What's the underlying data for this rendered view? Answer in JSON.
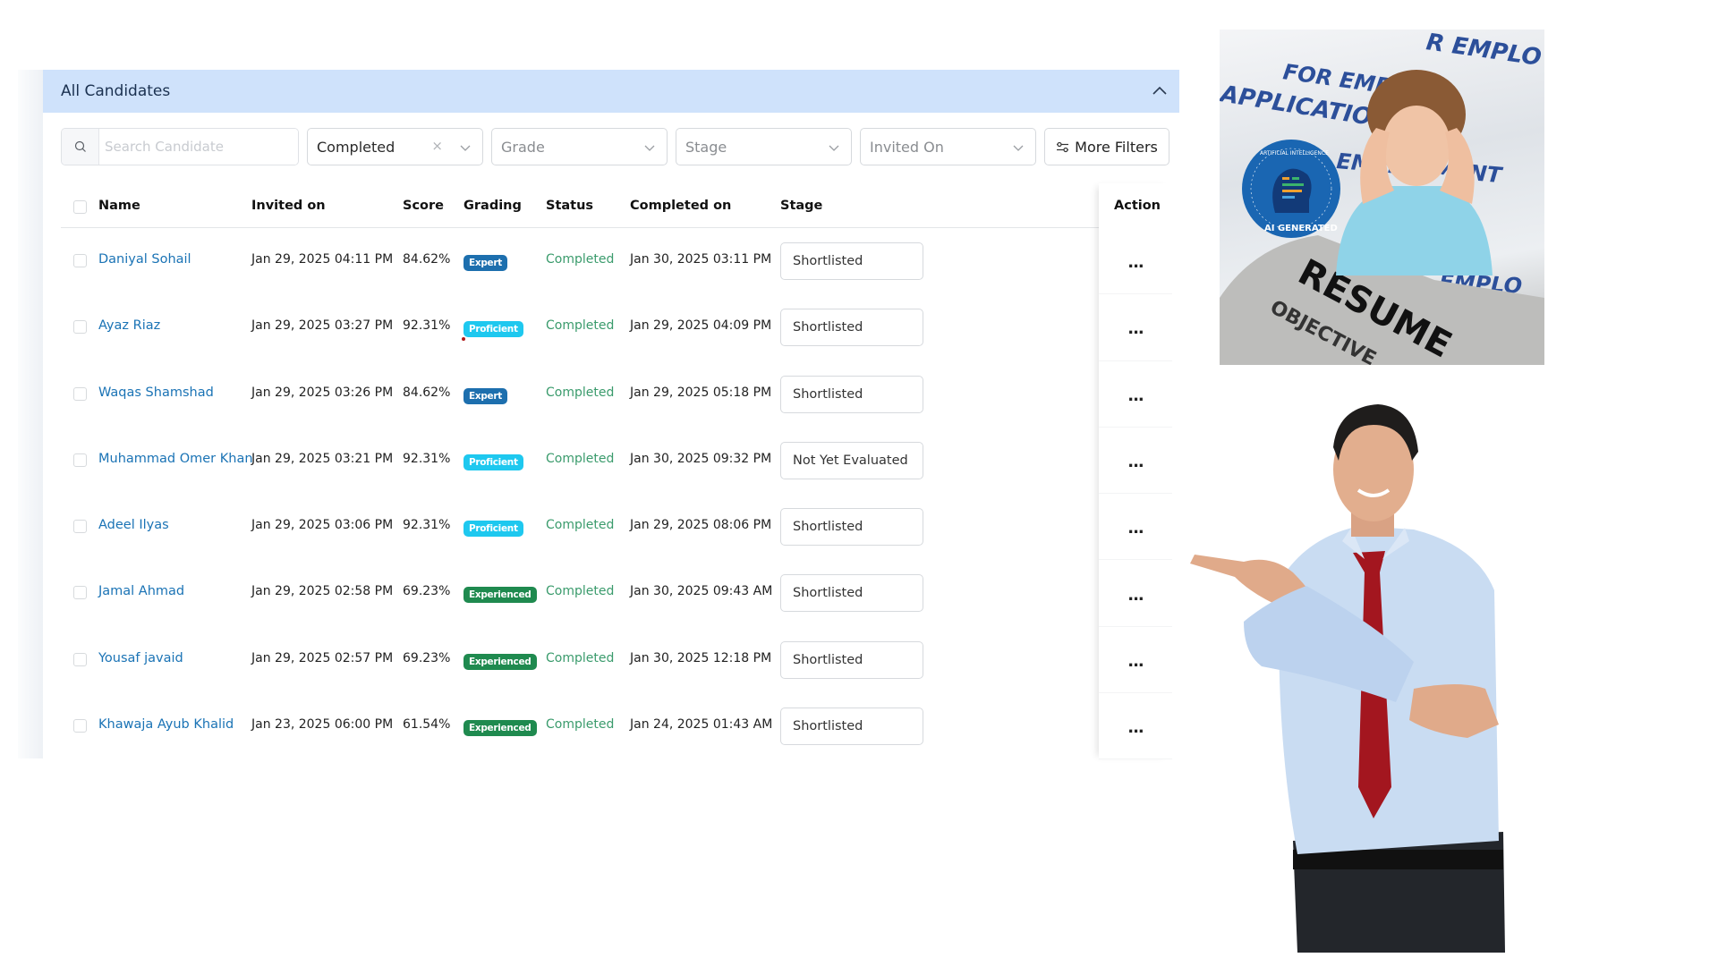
{
  "panel": {
    "title": "All Candidates",
    "collapse_icon": "chevron-up-icon"
  },
  "filters": {
    "search": {
      "placeholder": "Search Candidate",
      "value": "",
      "icon": "search-icon"
    },
    "status": {
      "value": "Completed",
      "clear_label": "×"
    },
    "grade": {
      "placeholder": "Grade"
    },
    "stage": {
      "placeholder": "Stage"
    },
    "invited_on": {
      "placeholder": "Invited On"
    },
    "more_filters": {
      "label": "More Filters",
      "icon": "sliders-icon"
    }
  },
  "table": {
    "columns": [
      "Name",
      "Invited on",
      "Score",
      "Grading",
      "Status",
      "Completed on",
      "Stage",
      "Action"
    ],
    "rows": [
      {
        "name": "Daniyal Sohail",
        "invited_on": "Jan 29, 2025 04:11 PM",
        "score": "84.62%",
        "grading": "Expert",
        "status": "Completed",
        "completed_on": "Jan 30, 2025 03:11 PM",
        "stage": "Shortlisted",
        "action": "..."
      },
      {
        "name": "Ayaz Riaz",
        "invited_on": "Jan 29, 2025 03:27 PM",
        "score": "92.31%",
        "grading": "Proficient",
        "status": "Completed",
        "completed_on": "Jan 29, 2025 04:09 PM",
        "stage": "Shortlisted",
        "action": "..."
      },
      {
        "name": "Waqas Shamshad",
        "invited_on": "Jan 29, 2025 03:26 PM",
        "score": "84.62%",
        "grading": "Expert",
        "status": "Completed",
        "completed_on": "Jan 29, 2025 05:18 PM",
        "stage": "Shortlisted",
        "action": "..."
      },
      {
        "name": "Muhammad Omer Khan",
        "invited_on": "Jan 29, 2025 03:21 PM",
        "score": "92.31%",
        "grading": "Proficient",
        "status": "Completed",
        "completed_on": "Jan 30, 2025 09:32 PM",
        "stage": "Not Yet Evaluated",
        "action": "..."
      },
      {
        "name": "Adeel Ilyas",
        "invited_on": "Jan 29, 2025 03:06 PM",
        "score": "92.31%",
        "grading": "Proficient",
        "status": "Completed",
        "completed_on": "Jan 29, 2025 08:06 PM",
        "stage": "Shortlisted",
        "action": "..."
      },
      {
        "name": "Jamal Ahmad",
        "invited_on": "Jan 29, 2025 02:58 PM",
        "score": "69.23%",
        "grading": "Experienced",
        "status": "Completed",
        "completed_on": "Jan 30, 2025 09:43 AM",
        "stage": "Shortlisted",
        "action": "..."
      },
      {
        "name": "Yousaf javaid",
        "invited_on": "Jan 29, 2025 02:57 PM",
        "score": "69.23%",
        "grading": "Experienced",
        "status": "Completed",
        "completed_on": "Jan 30, 2025 12:18 PM",
        "stage": "Shortlisted",
        "action": "..."
      },
      {
        "name": "Khawaja Ayub Khalid",
        "invited_on": "Jan 23, 2025 06:00 PM",
        "score": "61.54%",
        "grading": "Experienced",
        "status": "Completed",
        "completed_on": "Jan 24, 2025 01:43 AM",
        "stage": "Shortlisted",
        "action": "..."
      }
    ]
  },
  "grade_colors": {
    "Expert": "#1d6fae",
    "Proficient": "#1ec8ef",
    "Experienced": "#1f8a4f"
  },
  "colors": {
    "header_bg": "#cfe2fb",
    "name_link": "#1a73b5",
    "status_completed": "#3a9b6c"
  },
  "images": {
    "resume_photo": {
      "badge_top_text": "ARTIFICIAL INTELLIGENCE",
      "badge_bottom_text": "AI GENERATED",
      "headline": "RESUME",
      "subline": "OBJECTIVE",
      "paper_text_1": "APPLICATION",
      "paper_text_2": "FOR EMPLOYMENT"
    },
    "man_photo": {
      "description": "businessman-pointing"
    }
  }
}
